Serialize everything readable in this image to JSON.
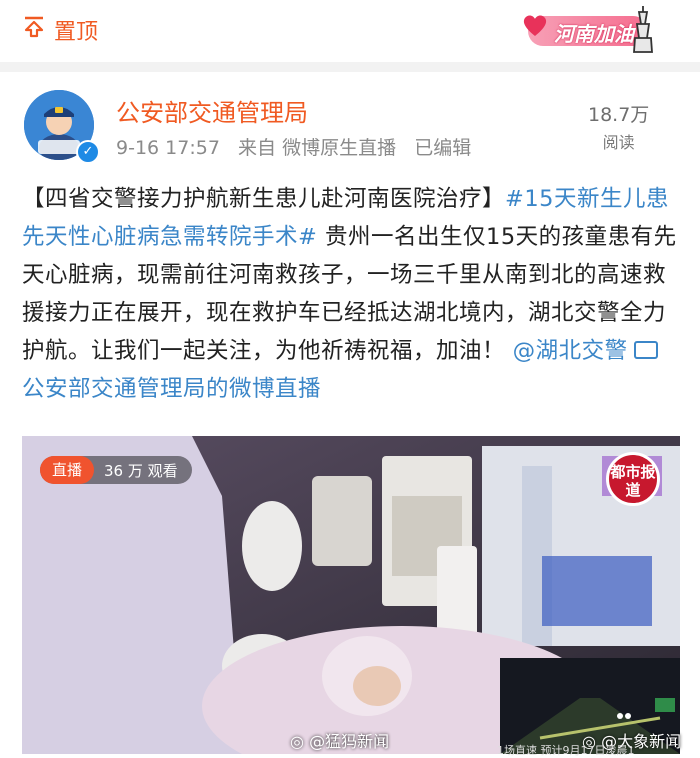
{
  "topbar": {
    "pin_label": "置顶",
    "badge_text": "河南加油",
    "colors": {
      "accent": "#f05a22",
      "badge": "#f56d8f"
    }
  },
  "post": {
    "author": "公安部交通管理局",
    "avatar_text": "公安交通管理",
    "time": "9-16 17:57",
    "source": "来自 微博原生直播",
    "edited": "已编辑",
    "views_count": "18.7万",
    "views_label": "阅读",
    "text": {
      "title": "【四省交警接力护航新生患儿赴河南医院治疗】",
      "hashtag": "#15天新生儿患先天性心脏病急需转院手术#",
      "body": " 贵州一名出生仅15天的孩童患有先天心脏病，现需前往河南救孩子，一场三千里从南到北的高速救援接力正在展开，现在救护车已经抵达湖北境内，湖北交警全力护航。让我们一起关注，为他祈祷祝福，加油！",
      "mention": "@湖北交警",
      "live_link": "公安部交通管理局的微博直播"
    },
    "colors": {
      "link": "#3b86c8",
      "text": "#222222"
    }
  },
  "video": {
    "live_tag": "直播",
    "viewer_count": "36 万 观看",
    "logo_text": "都市报道",
    "watermark_left": "@猛犸新闻",
    "watermark_right": "@大象新闻",
    "pip_caption": "1场直速 预计9月17日凌晨1"
  }
}
